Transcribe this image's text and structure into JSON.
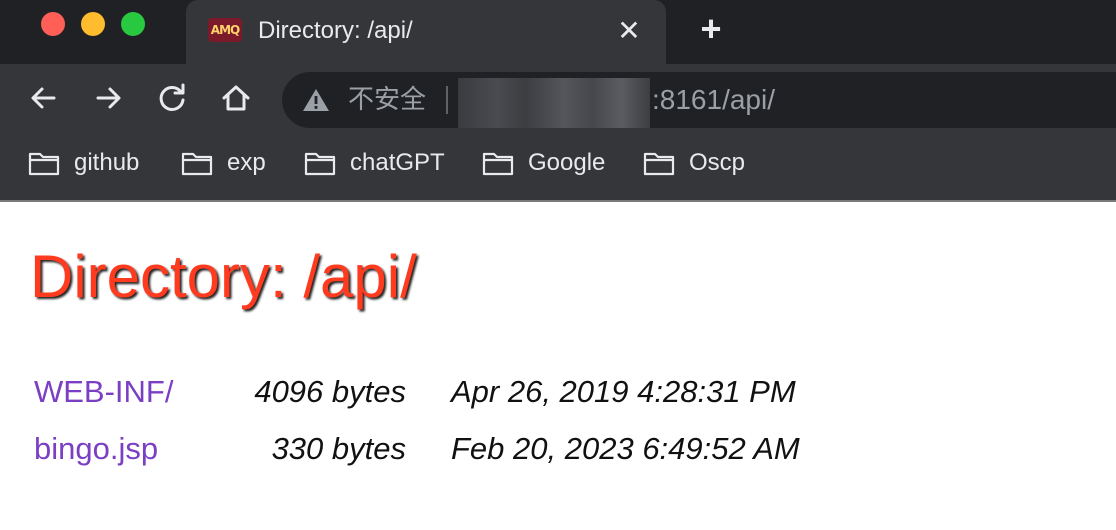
{
  "browser": {
    "tab": {
      "favicon_text": "AMQ",
      "title": "Directory: /api/",
      "close_symbol": "✕"
    },
    "new_tab_symbol": "+",
    "omnibox": {
      "security_label": "不安全",
      "url_visible": ":8161/api/"
    },
    "bookmarks": [
      {
        "label": "github"
      },
      {
        "label": "exp"
      },
      {
        "label": "chatGPT"
      },
      {
        "label": "Google"
      },
      {
        "label": "Oscp"
      }
    ],
    "icons": {
      "back": "arrow-left-icon",
      "forward": "arrow-right-icon",
      "reload": "reload-icon",
      "home": "home-icon",
      "warning": "warning-triangle-icon",
      "folder": "folder-icon"
    }
  },
  "page": {
    "heading": "Directory: /api/",
    "heading_color": "#ff3b1f",
    "link_color": "#7b3fc4",
    "entries": [
      {
        "name": "WEB-INF/",
        "size": "4096 bytes",
        "modified": "Apr 26, 2019 4:28:31 PM"
      },
      {
        "name": "bingo.jsp",
        "size": "330 bytes",
        "modified": "Feb 20, 2023 6:49:52 AM"
      }
    ]
  }
}
